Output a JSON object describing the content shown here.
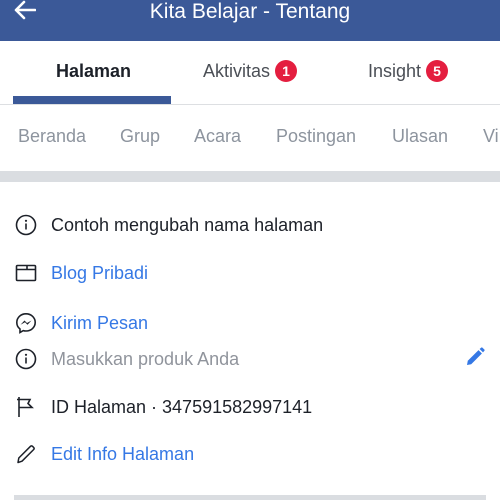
{
  "header": {
    "title": "Kita Belajar - Tentang",
    "back_icon": "arrow-left-icon",
    "background_color": "#3b5998"
  },
  "tabs": [
    {
      "label": "Halaman",
      "active": true,
      "badge": null
    },
    {
      "label": "Aktivitas",
      "active": false,
      "badge": "1"
    },
    {
      "label": "Insight",
      "active": false,
      "badge": "5"
    }
  ],
  "subnav": [
    "Beranda",
    "Grup",
    "Acara",
    "Postingan",
    "Ulasan",
    "Vi"
  ],
  "info": {
    "description": {
      "icon": "info-icon",
      "text": "Contoh mengubah nama halaman"
    },
    "website": {
      "icon": "browser-window-icon",
      "text": "Blog Pribadi"
    },
    "message": {
      "icon": "messenger-icon",
      "text": "Kirim Pesan"
    },
    "products": {
      "icon": "info-icon",
      "placeholder": "Masukkan produk Anda",
      "edit_icon": "pencil-icon"
    },
    "page_id": {
      "icon": "flag-icon",
      "text": "ID Halaman · 347591582997141"
    },
    "edit": {
      "icon": "pencil-outline-icon",
      "text": "Edit Info Halaman"
    }
  },
  "colors": {
    "accent": "#3b5998",
    "link": "#3578e5",
    "badge": "#e41e3f",
    "muted": "#8d949e"
  }
}
